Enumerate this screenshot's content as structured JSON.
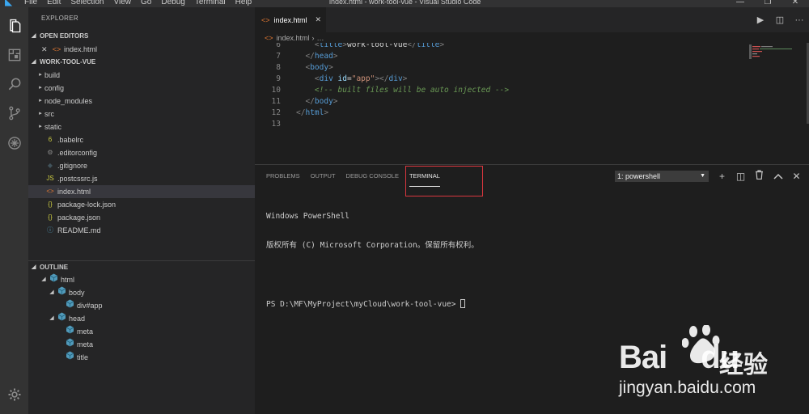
{
  "titlebar": {
    "menu": [
      "File",
      "Edit",
      "Selection",
      "View",
      "Go",
      "Debug",
      "Terminal",
      "Help"
    ],
    "window_title": "index.html - work-tool-vue - Visual Studio Code",
    "controls": [
      "—",
      "❐",
      "✕"
    ]
  },
  "activity": [
    "files-icon",
    "extensions-icon",
    "search-icon",
    "source-control-icon",
    "debug-icon",
    "gear-icon"
  ],
  "sidebar": {
    "title": "EXPLORER",
    "open_editors_label": "OPEN EDITORS",
    "open_editors": [
      {
        "label": "index.html"
      }
    ],
    "project_label": "WORK-TOOL-VUE",
    "tree": [
      {
        "label": "build",
        "kind": "folder"
      },
      {
        "label": "config",
        "kind": "folder"
      },
      {
        "label": "node_modules",
        "kind": "folder"
      },
      {
        "label": "src",
        "kind": "folder"
      },
      {
        "label": "static",
        "kind": "folder"
      },
      {
        "label": ".babelrc",
        "kind": "babel"
      },
      {
        "label": ".editorconfig",
        "kind": "gear"
      },
      {
        "label": ".gitignore",
        "kind": "git"
      },
      {
        "label": ".postcssrc.js",
        "kind": "js"
      },
      {
        "label": "index.html",
        "kind": "html"
      },
      {
        "label": "package-lock.json",
        "kind": "json"
      },
      {
        "label": "package.json",
        "kind": "json"
      },
      {
        "label": "README.md",
        "kind": "info"
      }
    ],
    "outline_label": "OUTLINE",
    "outline": [
      {
        "label": "html",
        "depth": 0,
        "twisty": "◢"
      },
      {
        "label": "body",
        "depth": 1,
        "twisty": "◢"
      },
      {
        "label": "div#app",
        "depth": 2,
        "twisty": ""
      },
      {
        "label": "head",
        "depth": 1,
        "twisty": "◢"
      },
      {
        "label": "meta",
        "depth": 2,
        "twisty": ""
      },
      {
        "label": "meta",
        "depth": 2,
        "twisty": ""
      },
      {
        "label": "title",
        "depth": 2,
        "twisty": ""
      }
    ]
  },
  "editor": {
    "tab_label": "index.html",
    "breadcrumb": [
      "index.html",
      "…"
    ],
    "lines": [
      {
        "n": "6",
        "html": "    <span class='t-brk'>&lt;</span><span class='t-tag'>title</span><span class='t-brk'>&gt;</span>work-tool-vue<span class='t-brk'>&lt;/</span><span class='t-tag'>title</span><span class='t-brk'>&gt;</span>"
      },
      {
        "n": "7",
        "html": "  <span class='t-brk'>&lt;/</span><span class='t-tag'>head</span><span class='t-brk'>&gt;</span>"
      },
      {
        "n": "8",
        "html": "  <span class='t-brk'>&lt;</span><span class='t-tag'>body</span><span class='t-brk'>&gt;</span>"
      },
      {
        "n": "9",
        "html": "    <span class='t-brk'>&lt;</span><span class='t-tag'>div</span> <span class='t-attr'>id</span>=<span class='t-str'>\"app\"</span><span class='t-brk'>&gt;&lt;/</span><span class='t-tag'>div</span><span class='t-brk'>&gt;</span>"
      },
      {
        "n": "10",
        "html": "    <span class='t-cmt'>&lt;!-- built files will be auto injected --&gt;</span>"
      },
      {
        "n": "11",
        "html": "  <span class='t-brk'>&lt;/</span><span class='t-tag'>body</span><span class='t-brk'>&gt;</span>"
      },
      {
        "n": "12",
        "html": "<span class='t-brk'>&lt;/</span><span class='t-tag'>html</span><span class='t-brk'>&gt;</span>"
      },
      {
        "n": "13",
        "html": ""
      }
    ]
  },
  "panel": {
    "tabs": [
      "PROBLEMS",
      "OUTPUT",
      "DEBUG CONSOLE",
      "TERMINAL"
    ],
    "active_tab": "TERMINAL",
    "terminal_select": "1: powershell",
    "actions": [
      "+",
      "◫",
      "🗑",
      "︿",
      "✕"
    ],
    "terminal_lines": [
      "Windows PowerShell",
      "版权所有 (C) Microsoft Corporation。保留所有权利。",
      "",
      "PS D:\\MF\\MyProject\\myCloud\\work-tool-vue> "
    ]
  },
  "watermark": {
    "brand_a": "Bai",
    "brand_b": "du",
    "brand_cn": "经验",
    "url": "jingyan.baidu.com"
  },
  "colors": {
    "accent_orange": "#e37933",
    "folder": "#c5c5c5",
    "json": "#cbcb41",
    "js": "#cbcb41",
    "info": "#519aba",
    "outline_icon": "#519aba"
  }
}
